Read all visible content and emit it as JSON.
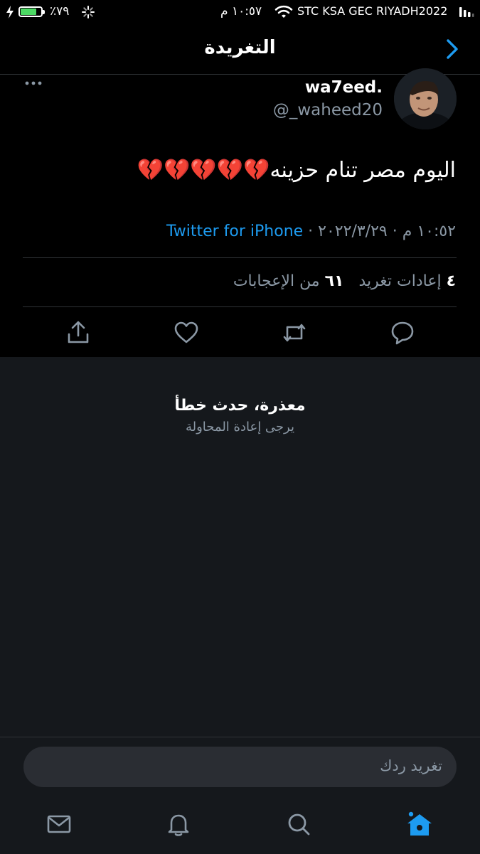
{
  "status_bar": {
    "battery_percent": "٪٧٩",
    "battery_level": 0.79,
    "time": "١٠:٥٧ م",
    "carrier": "STC KSA GEC RIYADH2022"
  },
  "header": {
    "title": "التغريدة"
  },
  "tweet": {
    "display_name": "wa7eed.",
    "handle": "@_waheed20",
    "text": "اليوم مصر تنام حزينه💔💔💔💔💔",
    "timestamp": "١٠:٥٢ م · ٢٠٢٢/٣/٢٩ ·",
    "source": "Twitter for iPhone",
    "retweets_count": "٤",
    "retweets_label": "إعادات تغريد",
    "likes_count": "٦١",
    "likes_label": "من الإعجابات"
  },
  "error": {
    "title": "معذرة، حدث خطأ",
    "subtitle": "يرجى إعادة المحاولة"
  },
  "reply": {
    "placeholder": "تغريد ردك"
  },
  "colors": {
    "accent": "#1d9bf0",
    "background": "#000000",
    "panel": "#15181c",
    "muted": "#8b98a5"
  }
}
